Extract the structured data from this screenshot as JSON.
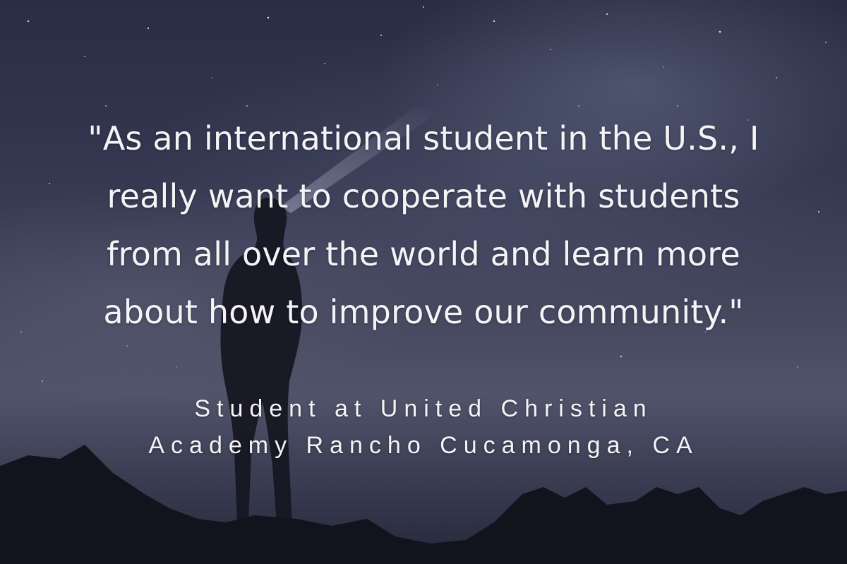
{
  "quote": {
    "lines": [
      "\"As an international student in the U.S., I",
      "really want to cooperate with students",
      "from all over the world and learn more",
      "about how to improve our community.\""
    ]
  },
  "attribution": {
    "lines": [
      "Student at United Christian",
      "Academy Rancho Cucamonga, CA"
    ]
  }
}
